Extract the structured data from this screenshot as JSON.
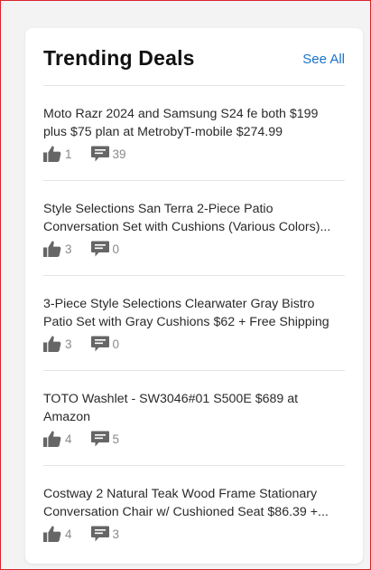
{
  "widget": {
    "title": "Trending Deals",
    "see_all_label": "See All"
  },
  "deals": [
    {
      "title": "Moto Razr 2024 and Samsung S24 fe both $199 plus $75 plan at MetrobyT-mobile $274.99",
      "likes": "1",
      "comments": "39"
    },
    {
      "title": "Style Selections San Terra 2-Piece Patio Conversation Set with Cushions (Various Colors)...",
      "likes": "3",
      "comments": "0"
    },
    {
      "title": "3-Piece Style Selections Clearwater Gray Bistro Patio Set with Gray Cushions $62 + Free Shipping",
      "likes": "3",
      "comments": "0"
    },
    {
      "title": "TOTO Washlet - SW3046#01 S500E $689 at Amazon",
      "likes": "4",
      "comments": "5"
    },
    {
      "title": "Costway 2 Natural Teak Wood Frame Stationary Conversation Chair w/ Cushioned Seat $86.39 +...",
      "likes": "4",
      "comments": "3"
    }
  ],
  "icons": {
    "like": "thumbs-up-icon",
    "comment": "comment-icon"
  },
  "colors": {
    "accent": "#1a73c9",
    "icon": "#666666",
    "frame": "#d9242b"
  }
}
